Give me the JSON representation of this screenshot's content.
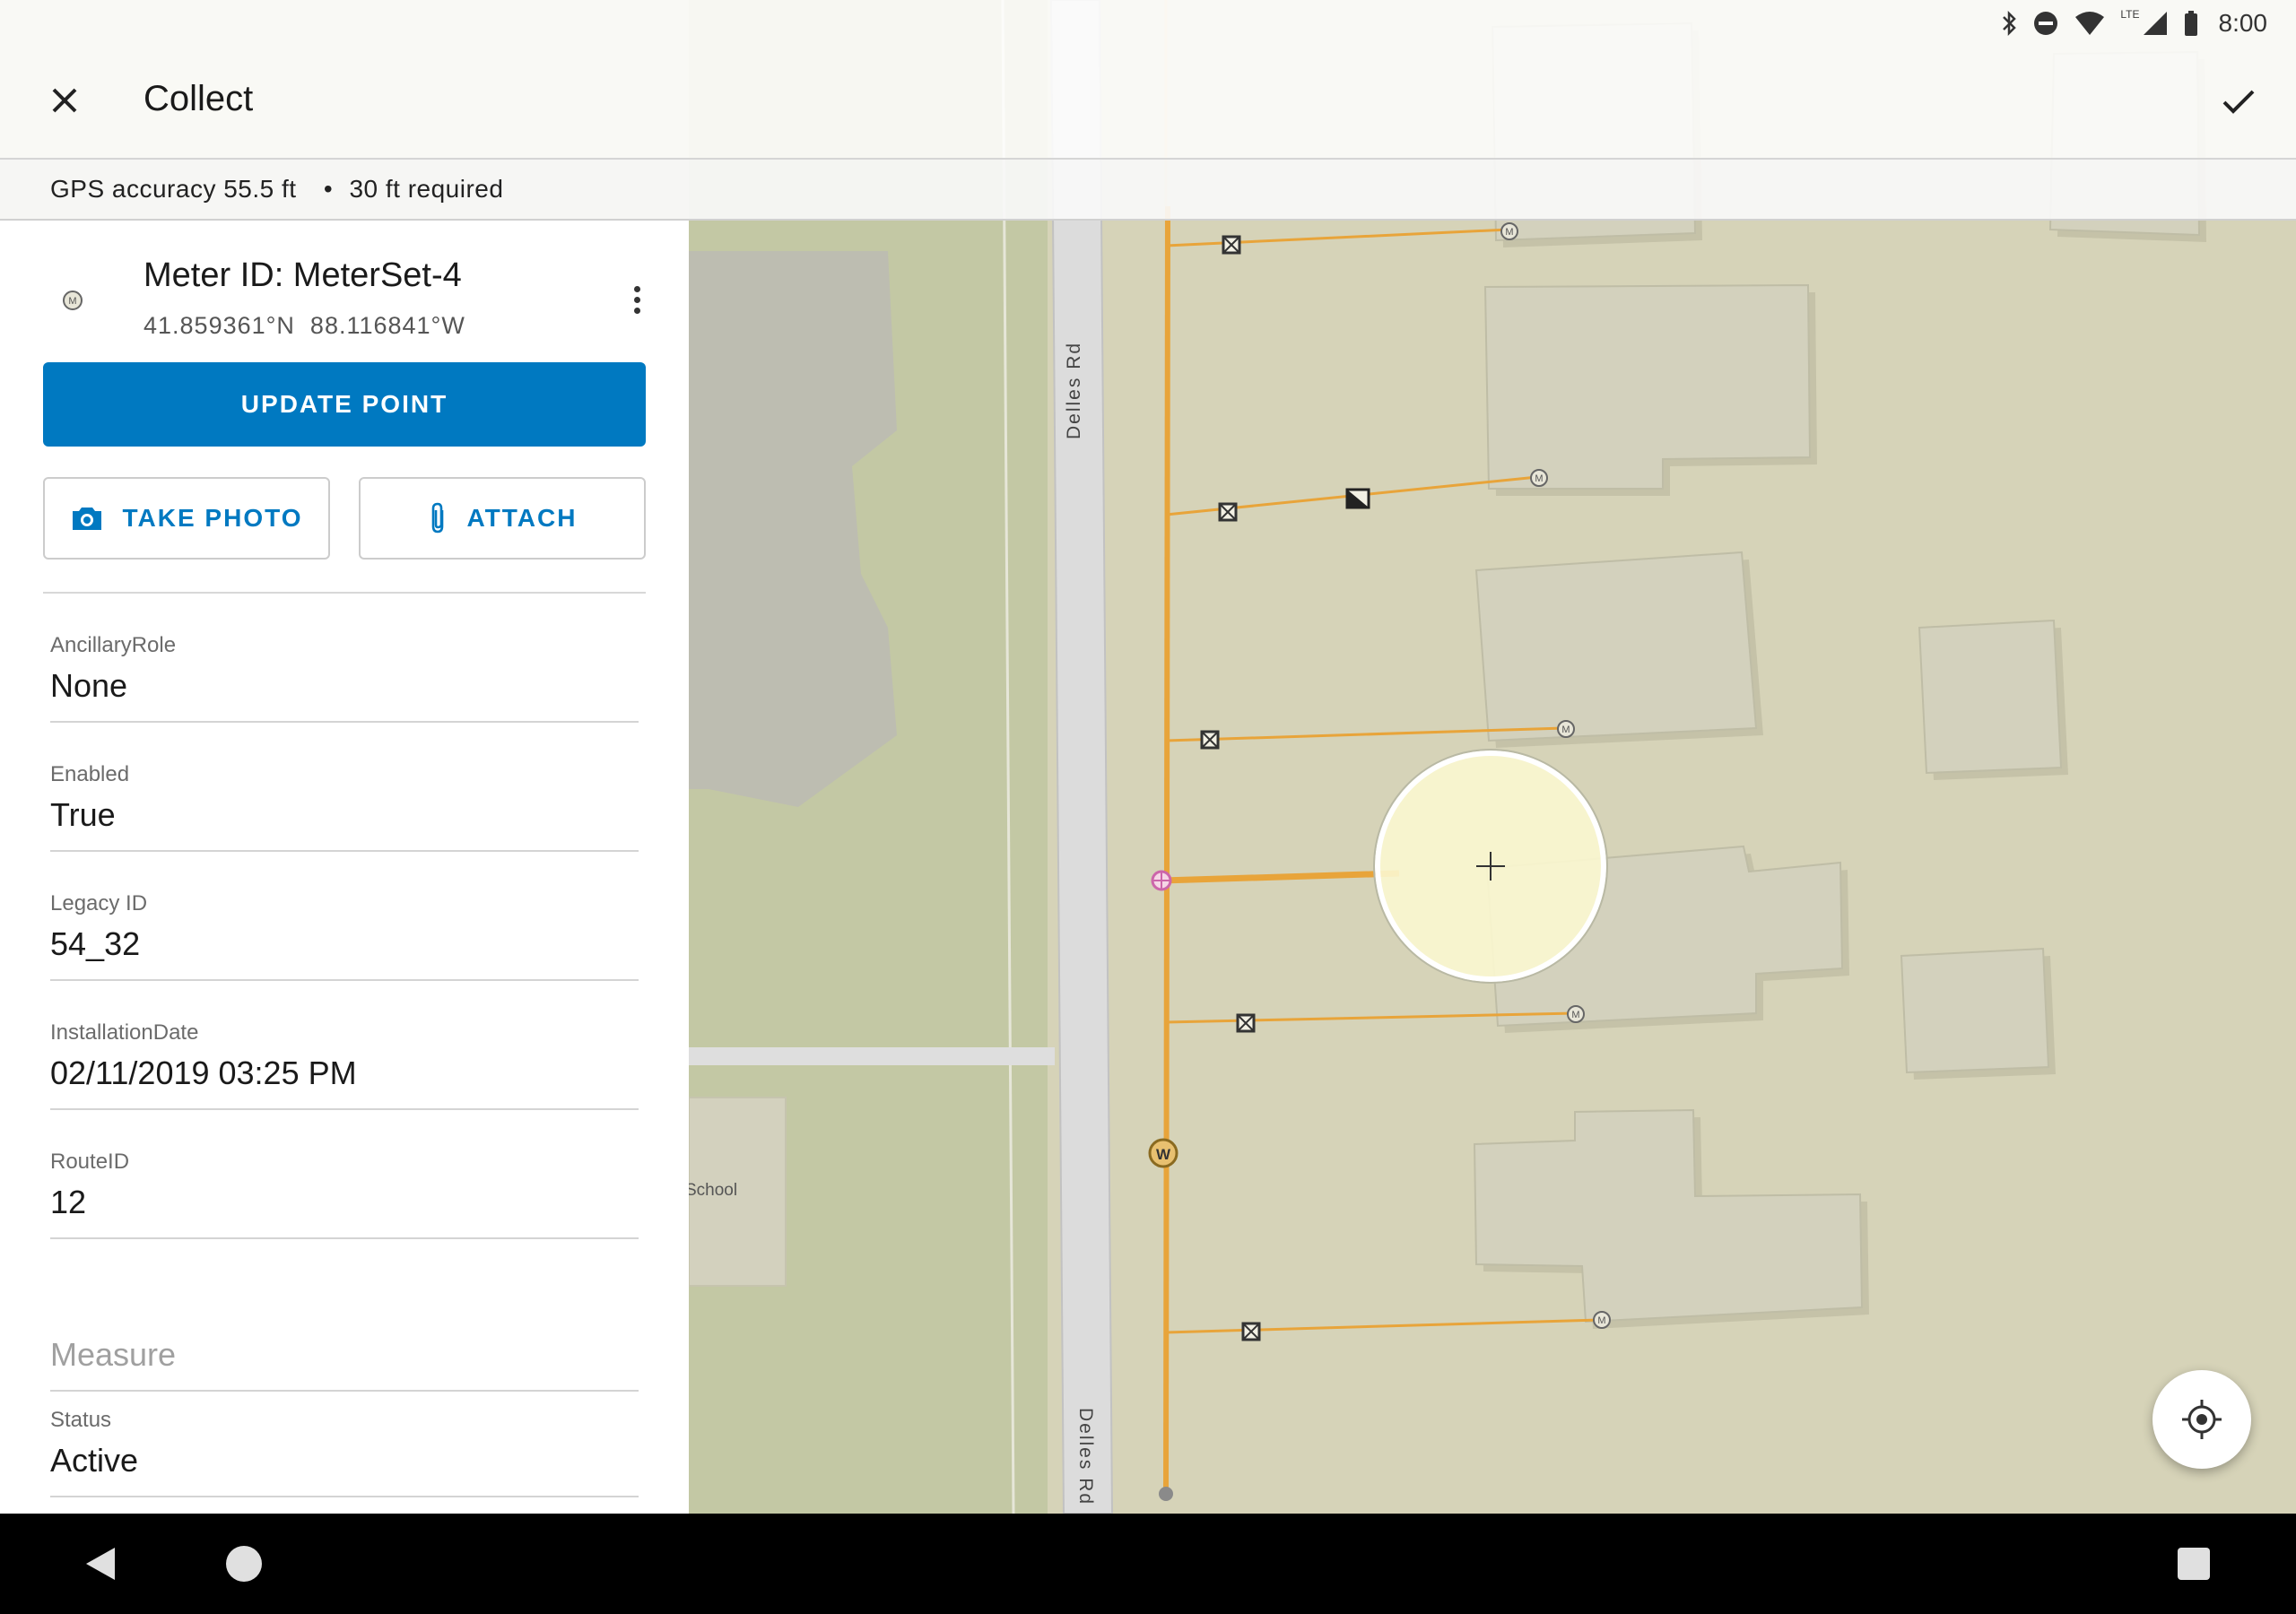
{
  "status_bar": {
    "time": "8:00",
    "network": "LTE"
  },
  "app_bar": {
    "title": "Collect"
  },
  "gps": {
    "accuracy_text": "GPS accuracy 55.5 ft",
    "separator": "•",
    "required_text": "30 ft required"
  },
  "feature": {
    "title": "Meter ID: MeterSet-4",
    "coords": "41.859361°N  88.116841°W",
    "icon_letter": "M"
  },
  "buttons": {
    "update": "UPDATE POINT",
    "take_photo": "TAKE PHOTO",
    "attach": "ATTACH"
  },
  "fields": [
    {
      "label": "AncillaryRole",
      "value": "None"
    },
    {
      "label": "Enabled",
      "value": "True"
    },
    {
      "label": "Legacy ID",
      "value": "54_32"
    },
    {
      "label": "InstallationDate",
      "value": "02/11/2019 03:25 PM"
    },
    {
      "label": "RouteID",
      "value": "12"
    },
    {
      "label": "",
      "placeholder": "Measure"
    },
    {
      "label": "Status",
      "value": "Active"
    }
  ],
  "map": {
    "road_label": "Delles Rd",
    "school_label": "School",
    "meter_letter": "M",
    "water_letter": "W",
    "colors": {
      "gas_line": "#e8a43a",
      "building": "#d0cfbd",
      "ground": "#d6d3b8",
      "accent": "#0079c1"
    }
  }
}
